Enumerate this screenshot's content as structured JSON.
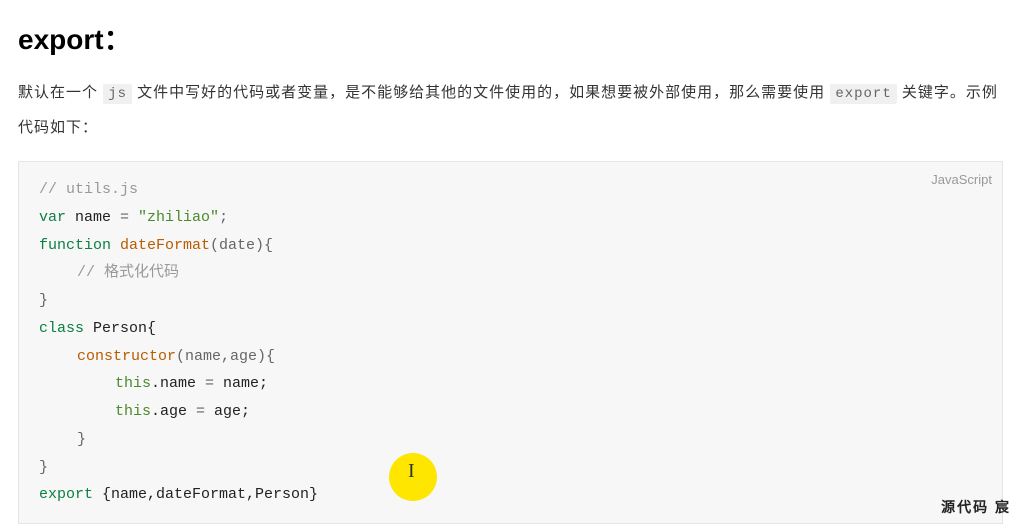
{
  "heading": "export：",
  "paragraph": {
    "part1": "默认在一个 ",
    "inline1": "js",
    "part2": " 文件中写好的代码或者变量，是不能够给其他的文件使用的，如果想要被外部使用，那么需要使用 ",
    "inline2": "export",
    "part3": " 关键字。示例代码如下："
  },
  "code": {
    "language": "JavaScript",
    "line1_comment": "// utils.js",
    "line2_kw": "var",
    "line2_name": " name ",
    "line2_eq": "= ",
    "line2_str": "\"zhiliao\"",
    "line2_semi": ";",
    "line3_kw": "function",
    "line3_func": " dateFormat",
    "line3_paren": "(date){",
    "line4_comment": "// 格式化代码",
    "line5_brace": "}",
    "line6_kw": "class",
    "line6_name": " Person{",
    "line7_ctor": "constructor",
    "line7_args": "(name,age){",
    "line8_this": "this",
    "line8_prop": ".name ",
    "line8_eq": "= ",
    "line8_val": "name;",
    "line9_this": "this",
    "line9_prop": ".age ",
    "line9_eq": "= ",
    "line9_val": "age;",
    "line10_brace": "}",
    "line11_brace": "}",
    "line12_kw": "export",
    "line12_rest": " {name,dateFormat,Person}"
  },
  "cursor_glyph": "I",
  "watermark": "源代码  宸"
}
